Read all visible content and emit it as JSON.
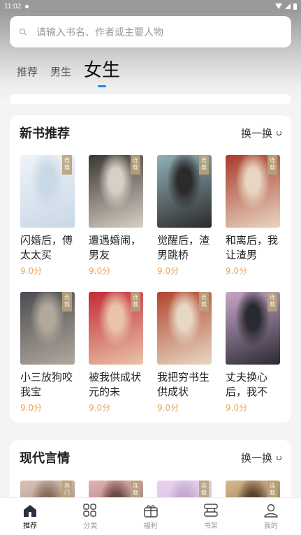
{
  "status": {
    "time": "11:02"
  },
  "search": {
    "placeholder": "请输入书名、作者或主要人物"
  },
  "tabs": [
    {
      "label": "推荐"
    },
    {
      "label": "男生"
    },
    {
      "label": "女生"
    }
  ],
  "sections": [
    {
      "title": "新书推荐",
      "refresh_label": "换一换",
      "books": [
        {
          "title": "闪婚后，傅太太买",
          "score": "9.0分",
          "tag": "连载",
          "cover_colors": [
            "#eef3f8",
            "#c9d8e6"
          ]
        },
        {
          "title": "遭遇婚闹，男友",
          "score": "9.0分",
          "tag": "连载",
          "cover_colors": [
            "#3a3632",
            "#d7d0c6"
          ]
        },
        {
          "title": "觉醒后，渣男跳桥",
          "score": "9.0分",
          "tag": "连载",
          "cover_colors": [
            "#8fb0b8",
            "#2c2a2b"
          ]
        },
        {
          "title": "和离后，我让渣男",
          "score": "9.0分",
          "tag": "连载",
          "cover_colors": [
            "#a93a2c",
            "#e8d6c2"
          ]
        },
        {
          "title": "小三放狗咬我宝",
          "score": "9.0分",
          "tag": "连载",
          "cover_colors": [
            "#4b4d52",
            "#b2a89c"
          ]
        },
        {
          "title": "被我供成状元的未",
          "score": "9.0分",
          "tag": "连载",
          "cover_colors": [
            "#c52a3a",
            "#e9c4a8"
          ]
        },
        {
          "title": "我把穷书生供成状",
          "score": "9.0分",
          "tag": "连载",
          "cover_colors": [
            "#b3452e",
            "#e6d8c4"
          ]
        },
        {
          "title": "丈夫换心后，我不",
          "score": "9.0分",
          "tag": "连载",
          "cover_colors": [
            "#c9a6c9",
            "#2a2a33"
          ]
        }
      ]
    },
    {
      "title": "现代言情",
      "refresh_label": "换一换",
      "books": [
        {
          "tag": "热门",
          "cover_colors": [
            "#d7c3b6",
            "#8a6a5b"
          ]
        },
        {
          "tag": "连载",
          "cover_colors": [
            "#e3b3b3",
            "#6d4a45"
          ]
        },
        {
          "tag": "连载",
          "cover_colors": [
            "#e8d4ee",
            "#c3a8d1"
          ]
        },
        {
          "tag": "连载",
          "cover_colors": [
            "#d9b98a",
            "#5a4030"
          ]
        }
      ]
    }
  ],
  "bottom_nav": [
    {
      "label": "推荐",
      "icon": "home-icon",
      "active": true
    },
    {
      "label": "分类",
      "icon": "grid-icon",
      "active": false
    },
    {
      "label": "福利",
      "icon": "gift-icon",
      "active": false
    },
    {
      "label": "书架",
      "icon": "bookshelf-icon",
      "active": false
    },
    {
      "label": "我的",
      "icon": "user-icon",
      "active": false
    }
  ]
}
